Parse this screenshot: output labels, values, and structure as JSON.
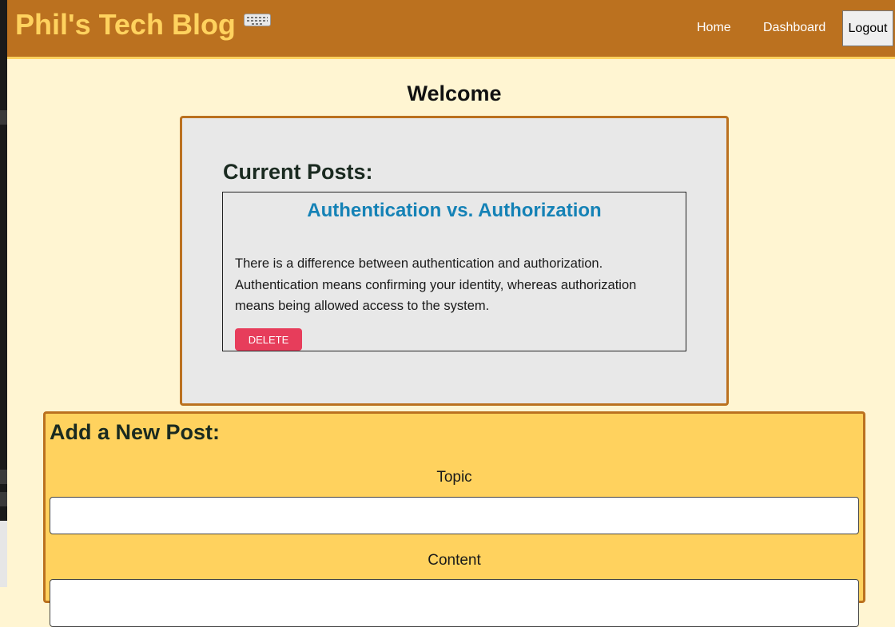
{
  "header": {
    "brand": "Phil's Tech Blog",
    "brand_icon": "keyboard-icon",
    "nav": {
      "home": "Home",
      "dashboard": "Dashboard",
      "logout": "Logout"
    }
  },
  "main": {
    "welcome": "Welcome",
    "current_posts": {
      "heading": "Current Posts:",
      "posts": [
        {
          "title": "Authentication vs. Authorization",
          "body": "There is a difference between authentication and authorization. Authentication means confirming your identity, whereas authorization means being allowed access to the system.",
          "delete_label": "DELETE"
        }
      ]
    },
    "new_post": {
      "heading": "Add a New Post:",
      "topic_label": "Topic",
      "topic_value": "",
      "content_label": "Content",
      "content_value": ""
    }
  },
  "colors": {
    "header_bg": "#bb711f",
    "brand": "#ffd25e",
    "page_bg": "#fff5d2",
    "post_title": "#1582b6",
    "delete": "#e73d5b"
  }
}
